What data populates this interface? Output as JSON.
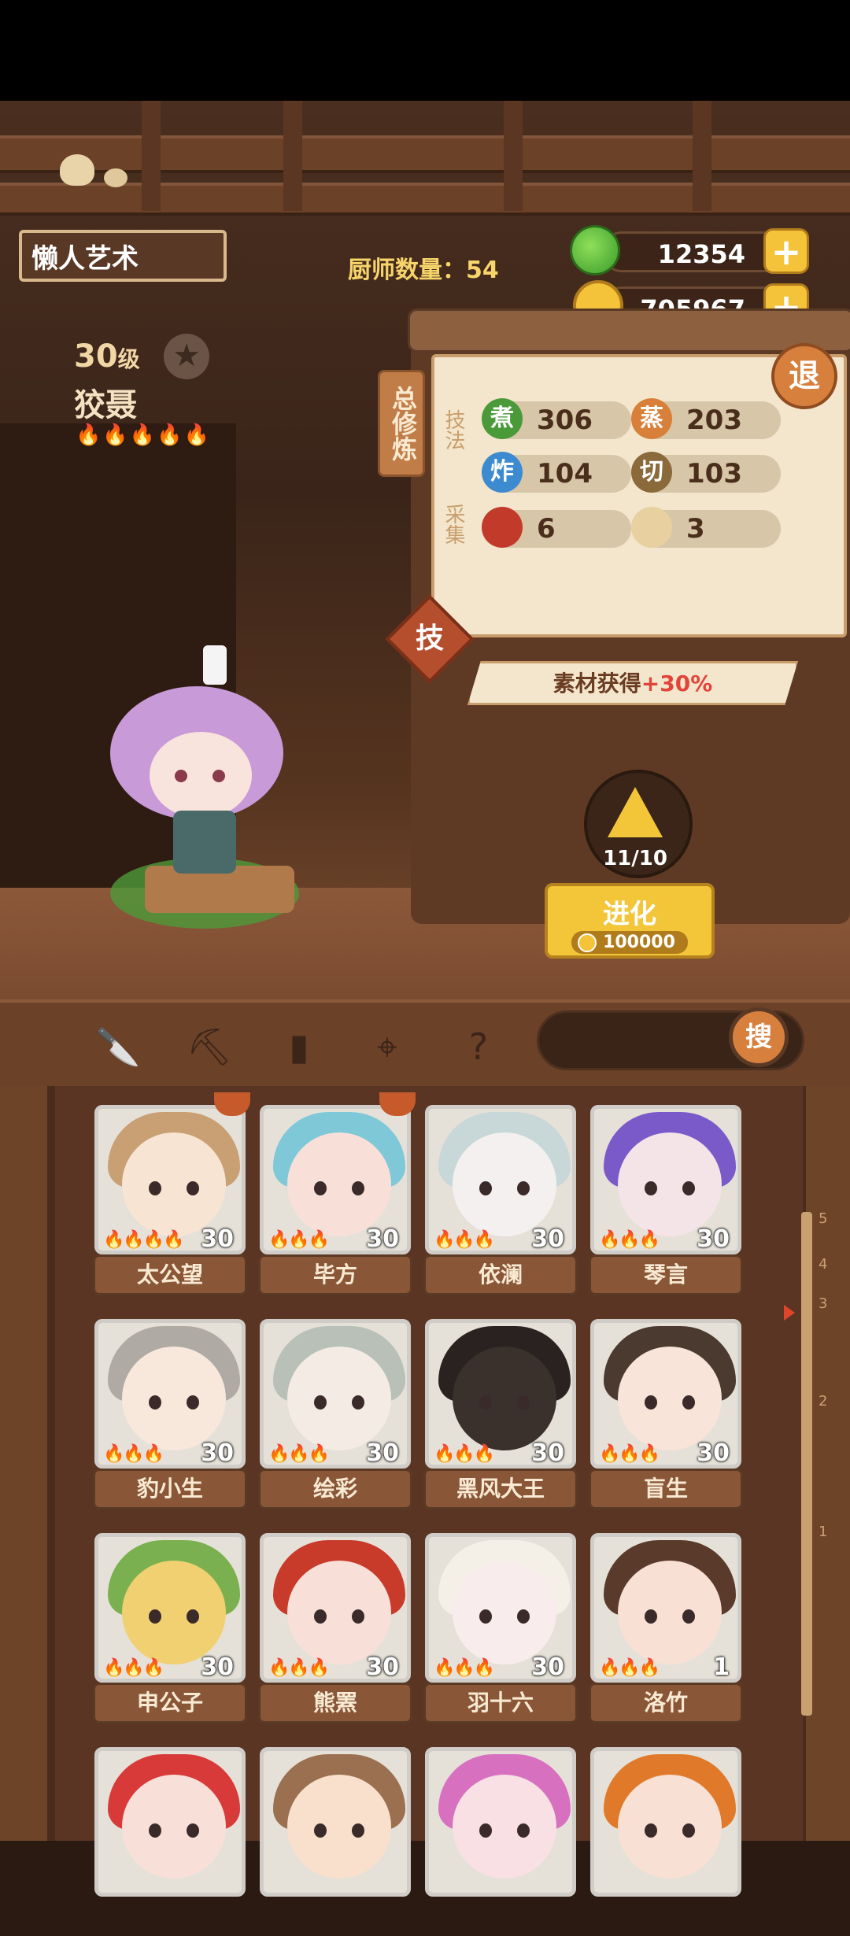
{
  "header": {
    "player_name": "懒人艺术",
    "chef_count_label": "厨师数量：54",
    "jade": "12354",
    "coins": "705967",
    "plus": "+"
  },
  "chef": {
    "level": "30",
    "level_unit": "级",
    "name": "狡聂",
    "flames": "🔥🔥🔥🔥🔥"
  },
  "panel": {
    "vertical_title": "总修炼",
    "tech_label": "技法",
    "gather_label": "采集",
    "exit_label": "退",
    "skill_label": "技",
    "stats": [
      {
        "icon": "煮",
        "value": "306",
        "color": "#4a9a3a"
      },
      {
        "icon": "蒸",
        "value": "203",
        "color": "#d8803a"
      },
      {
        "icon": "炸",
        "value": "104",
        "color": "#3c8ad0"
      },
      {
        "icon": "切",
        "value": "103",
        "color": "#8a6a3a"
      },
      {
        "icon": "",
        "value": "6",
        "color": "#c23a2a"
      },
      {
        "icon": "",
        "value": "3",
        "color": "#e8d0a0"
      }
    ],
    "bonus_text": "素材获得",
    "bonus_value": "+30%",
    "evolve_count": "11/10",
    "evolve_label": "进化",
    "evolve_cost": "100000"
  },
  "search": {
    "button": "搜",
    "placeholder": ""
  },
  "filter_icons": [
    "knife-icon",
    "shovel-icon",
    "jar-icon",
    "location-pin-icon",
    "map-question-icon"
  ],
  "ruler": [
    "5",
    "4",
    "3",
    "2",
    "1"
  ],
  "chefs": [
    {
      "name": "太公望",
      "level": "30",
      "flames": "🔥🔥🔥🔥",
      "hair": "#c8a074",
      "face": "#f8e4d2",
      "badge": true
    },
    {
      "name": "毕方",
      "level": "30",
      "flames": "🔥🔥🔥",
      "hair": "#7ec8d8",
      "face": "#f8e0d8",
      "badge": true
    },
    {
      "name": "依澜",
      "level": "30",
      "flames": "🔥🔥🔥",
      "hair": "#c8d8d8",
      "face": "#f4f0f0",
      "badge": false
    },
    {
      "name": "琴言",
      "level": "30",
      "flames": "🔥🔥🔥",
      "hair": "#7a5ac8",
      "face": "#f4e4e8",
      "badge": false
    },
    {
      "name": "豹小生",
      "level": "30",
      "flames": "🔥🔥🔥",
      "hair": "#b0aaa4",
      "face": "#f8e8dc",
      "badge": false
    },
    {
      "name": "绘彩",
      "level": "30",
      "flames": "🔥🔥🔥",
      "hair": "#b8c0b8",
      "face": "#f4ece4",
      "badge": false
    },
    {
      "name": "黑风大王",
      "level": "30",
      "flames": "🔥🔥🔥",
      "hair": "#2a2220",
      "face": "#3a302c",
      "badge": false
    },
    {
      "name": "盲生",
      "level": "30",
      "flames": "🔥🔥🔥",
      "hair": "#4a3a30",
      "face": "#f8e4d8",
      "badge": false
    },
    {
      "name": "申公子",
      "level": "30",
      "flames": "🔥🔥🔥",
      "hair": "#7ab050",
      "face": "#f0d070",
      "badge": false
    },
    {
      "name": "熊罴",
      "level": "30",
      "flames": "🔥🔥🔥",
      "hair": "#c83a2a",
      "face": "#f8e0d8",
      "badge": false
    },
    {
      "name": "羽十六",
      "level": "30",
      "flames": "🔥🔥🔥",
      "hair": "#f4f0e8",
      "face": "#f8ecec",
      "badge": false
    },
    {
      "name": "洛竹",
      "level": "1",
      "flames": "🔥🔥🔥",
      "hair": "#5a3a2a",
      "face": "#f8e0d4",
      "badge": false
    },
    {
      "name": "",
      "level": "",
      "flames": "",
      "hair": "#d83a3a",
      "face": "#f8e0d8",
      "badge": false
    },
    {
      "name": "",
      "level": "",
      "flames": "",
      "hair": "#9a7050",
      "face": "#f8e0cc",
      "badge": false
    },
    {
      "name": "",
      "level": "",
      "flames": "",
      "hair": "#d870c0",
      "face": "#f8e0e4",
      "badge": false
    },
    {
      "name": "",
      "level": "",
      "flames": "",
      "hair": "#e07a2a",
      "face": "#f8e0d4",
      "badge": false
    }
  ]
}
